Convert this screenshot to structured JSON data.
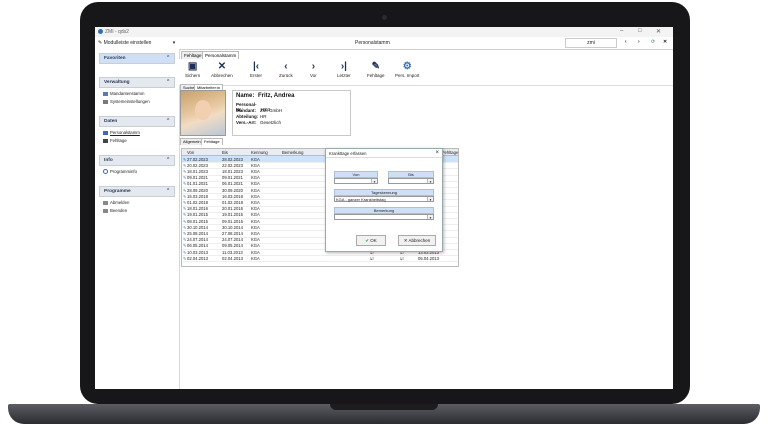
{
  "window": {
    "title": "ZMI - qds2",
    "app_title": "Personalstamm",
    "user": "zmi",
    "controls": [
      "–",
      "□",
      "✕"
    ]
  },
  "menubar": {
    "module_toggle": "Modulleiste einstellen",
    "nav_icons": [
      "‹",
      "›",
      "⟳",
      "✕"
    ]
  },
  "sidebar": {
    "sections": [
      {
        "label": "Favoriten",
        "active": true,
        "items": []
      },
      {
        "label": "Verwaltung",
        "active": false,
        "items": [
          "Mandantenstamm",
          "Systemeinstellungen"
        ]
      },
      {
        "label": "Daten",
        "active": false,
        "items": [
          "Personalstamm",
          "Fehltage"
        ]
      },
      {
        "label": "Info",
        "active": false,
        "items": [
          "Programminfo"
        ]
      },
      {
        "label": "Programme",
        "active": false,
        "items": [
          "Abmelden",
          "Beenden"
        ]
      }
    ],
    "collapse_icon": "⌃"
  },
  "top_tabs": [
    "Fehltage",
    "Personalstamm"
  ],
  "toolbar": {
    "buttons": [
      {
        "label": "Sichern",
        "icon": "save-icon",
        "glyph": "▣"
      },
      {
        "label": "Abbrechen",
        "icon": "cancel-icon",
        "glyph": "✕"
      },
      {
        "label": "Erster",
        "icon": "first-icon",
        "glyph": "|‹"
      },
      {
        "label": "Zurück",
        "icon": "back-icon",
        "glyph": "‹"
      },
      {
        "label": "Vor",
        "icon": "forward-icon",
        "glyph": "›"
      },
      {
        "label": "Letzter",
        "icon": "last-icon",
        "glyph": "›|"
      },
      {
        "label": "Fehltage",
        "icon": "pen-icon",
        "glyph": "✎"
      },
      {
        "label": "Pers. Import",
        "icon": "import-icon",
        "glyph": "⚙"
      }
    ]
  },
  "search_tabs": [
    "Suche",
    "Mitarbeiter:in"
  ],
  "employee": {
    "name_label": "Name:",
    "name": "Fritz, Andrea",
    "fields": [
      {
        "k": "Personal-Nr.:",
        "v": "1003"
      },
      {
        "k": "Mandant:",
        "v": "ZMI GmbH"
      },
      {
        "k": "Abteilung:",
        "v": "HR"
      },
      {
        "k": "Vers.-Art:",
        "v": "Gesetzlich"
      }
    ]
  },
  "detail_tabs": [
    "Allgemein",
    "Fehltage"
  ],
  "grid": {
    "columns": [
      "Von",
      "Bis",
      "Kennung",
      "Bemerkung"
    ],
    "extra_column": "Fehltage",
    "rows": [
      {
        "von": "27.02.2023",
        "bis": "28.02.2023",
        "kennung": "KGA"
      },
      {
        "von": "20.02.2023",
        "bis": "22.02.2023",
        "kennung": "KGA"
      },
      {
        "von": "18.01.2023",
        "bis": "18.01.2023",
        "kennung": "KGA"
      },
      {
        "von": "09.01.2021",
        "bis": "09.01.2021",
        "kennung": "KGA"
      },
      {
        "von": "01.01.2021",
        "bis": "06.01.2021",
        "kennung": "KGA"
      },
      {
        "von": "28.09.2020",
        "bis": "30.09.2020",
        "kennung": "KGA"
      },
      {
        "von": "15.03.2018",
        "bis": "16.03.2018",
        "kennung": "KGA"
      },
      {
        "von": "01.02.2018",
        "bis": "01.02.2018",
        "kennung": "KGA"
      },
      {
        "von": "18.01.2016",
        "bis": "20.01.2016",
        "kennung": "KGA"
      },
      {
        "von": "19.01.2015",
        "bis": "19.01.2015",
        "kennung": "KGA"
      },
      {
        "von": "08.01.2015",
        "bis": "09.01.2015",
        "kennung": "KGA"
      },
      {
        "von": "30.10.2014",
        "bis": "30.10.2014",
        "kennung": "KGA"
      },
      {
        "von": "25.08.2014",
        "bis": "27.08.2014",
        "kennung": "KGA"
      },
      {
        "von": "24.07.2014",
        "bis": "24.07.2014",
        "kennung": "KGA"
      },
      {
        "von": "06.05.2014",
        "bis": "09.05.2014",
        "kennung": "KGA"
      },
      {
        "von": "10.03.2013",
        "bis": "11.03.2013",
        "kennung": "KGA"
      },
      {
        "von": "02.04.2013",
        "bis": "02.04.2013",
        "kennung": "KGA"
      }
    ],
    "right_dates": [
      "13.03.2013",
      "05.04.2013"
    ]
  },
  "dialog": {
    "title": "Krankttage erfassen",
    "close": "×",
    "von_label": "Von",
    "bis_label": "Bis",
    "von_value": "",
    "bis_value": "",
    "tageskennung_label": "Tageskennung",
    "tageskennung_value": "KGA - ganzer Krankheitstag",
    "bemerkung_label": "Bemerkung",
    "bemerkung_value": "",
    "ok_label": "OK",
    "cancel_label": "Abbrechen"
  }
}
